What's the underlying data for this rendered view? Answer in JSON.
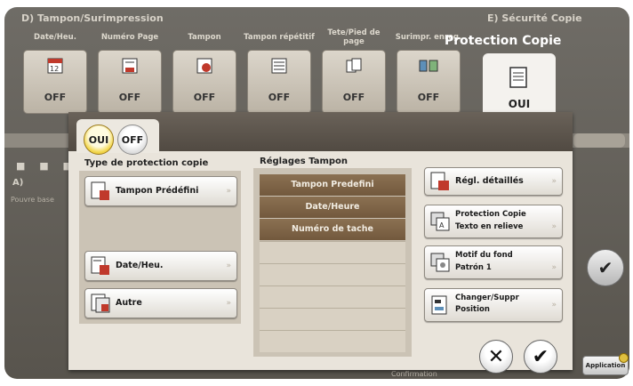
{
  "background": {
    "section_d_title": "D)  Tampon/Surimpression",
    "section_e_title": "E)  Sécurité Copie",
    "function_buttons": [
      {
        "label": "Date/Heu.",
        "status": "OFF",
        "icon": "date-stamp-icon"
      },
      {
        "label": "Numéro Page",
        "status": "OFF",
        "icon": "page-number-icon"
      },
      {
        "label": "Tampon",
        "status": "OFF",
        "icon": "stamp-icon"
      },
      {
        "label": "Tampon répétitif",
        "status": "OFF",
        "icon": "repeat-stamp-icon"
      },
      {
        "label": "Tete/Pied de page",
        "status": "OFF",
        "icon": "header-footer-icon"
      },
      {
        "label": "Surimpr. enreg.",
        "status": "OFF",
        "icon": "overlay-icon"
      }
    ],
    "protection_tab": {
      "title": "Protection Copie",
      "status": "OUI",
      "icon": "copy-protect-icon"
    },
    "side_label_a": "A)",
    "side_sub": "Pouvre base",
    "application_button": "Application",
    "footer_text": "Confirmation"
  },
  "dialog": {
    "toggle_on": "OUI",
    "toggle_off": "OFF",
    "left_title": "Type de protection copie",
    "left_buttons": [
      {
        "label": "Tampon Prédéfini",
        "icon": "preset-stamp-icon"
      },
      {
        "label": "Date/Heu.",
        "icon": "date-stamp-icon"
      },
      {
        "label": "Autre",
        "icon": "other-icon"
      }
    ],
    "middle_title": "Réglages Tampon",
    "middle_rows": [
      "Tampon Predefini",
      "Date/Heure",
      "Numéro de tache",
      "",
      "",
      "",
      "",
      ""
    ],
    "right_buttons": [
      {
        "label": "Régl. détaillés",
        "icon": "detail-settings-icon"
      },
      {
        "label": "Protection Copie",
        "value": "Texto en relieve",
        "icon": "protect-pattern-icon"
      },
      {
        "label": "Motif du fond",
        "value": "Patrón 1",
        "icon": "background-pattern-icon"
      },
      {
        "label": "Changer/Suppr",
        "value": "Position",
        "icon": "change-position-icon"
      }
    ],
    "arrow_glyph": "»",
    "cancel_glyph": "✕",
    "ok_glyph": "✔"
  }
}
